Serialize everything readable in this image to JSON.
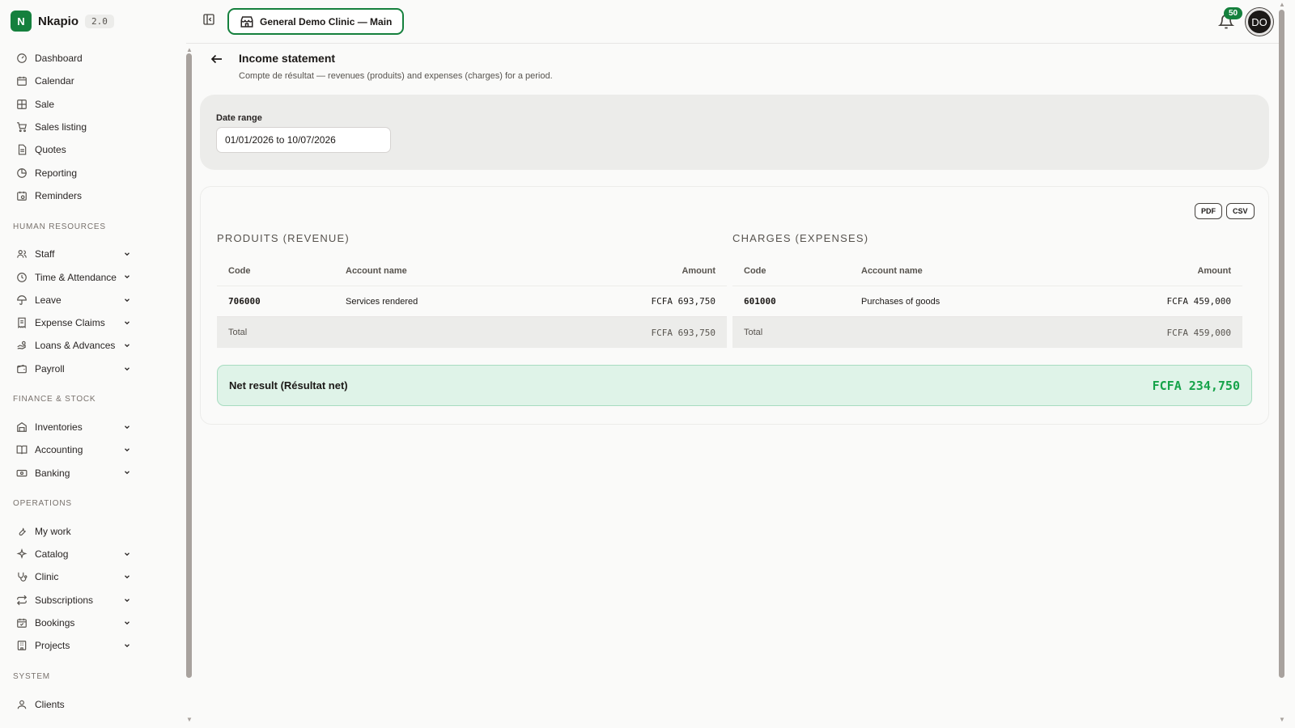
{
  "brand": {
    "initial": "N",
    "name": "Nkapio",
    "version": "2.0"
  },
  "sidebar": {
    "main": [
      {
        "label": "Dashboard",
        "icon": "gauge-icon"
      },
      {
        "label": "Calendar",
        "icon": "calendar-icon"
      },
      {
        "label": "Sale",
        "icon": "pos-grid-icon"
      },
      {
        "label": "Sales listing",
        "icon": "cart-icon"
      },
      {
        "label": "Quotes",
        "icon": "document-icon"
      },
      {
        "label": "Reporting",
        "icon": "pie-chart-icon"
      },
      {
        "label": "Reminders",
        "icon": "calendar-clock-icon"
      }
    ],
    "hr_title": "HUMAN RESOURCES",
    "hr": [
      {
        "label": "Staff",
        "icon": "users-icon"
      },
      {
        "label": "Time & Attendance",
        "icon": "clock-icon"
      },
      {
        "label": "Leave",
        "icon": "umbrella-icon"
      },
      {
        "label": "Expense Claims",
        "icon": "receipt-icon"
      },
      {
        "label": "Loans & Advances",
        "icon": "hand-coins-icon"
      },
      {
        "label": "Payroll",
        "icon": "wallet-icon"
      }
    ],
    "finance_title": "FINANCE & STOCK",
    "finance": [
      {
        "label": "Inventories",
        "icon": "warehouse-icon"
      },
      {
        "label": "Accounting",
        "icon": "book-icon"
      },
      {
        "label": "Banking",
        "icon": "banknote-icon"
      }
    ],
    "ops_title": "OPERATIONS",
    "ops": [
      {
        "label": "My work",
        "icon": "wrench-icon"
      },
      {
        "label": "Catalog",
        "icon": "sparkles-icon"
      },
      {
        "label": "Clinic",
        "icon": "stethoscope-icon"
      },
      {
        "label": "Subscriptions",
        "icon": "repeat-icon"
      },
      {
        "label": "Bookings",
        "icon": "calendar-check-icon"
      },
      {
        "label": "Projects",
        "icon": "building-icon"
      }
    ],
    "system_title": "SYSTEM",
    "system": [
      {
        "label": "Clients",
        "icon": "user-icon"
      }
    ]
  },
  "topbar": {
    "location": "General Demo Clinic — Main",
    "notifications": "50",
    "avatar": "DO"
  },
  "page": {
    "title": "Income statement",
    "subtitle": "Compte de résultat — revenues (produits) and expenses (charges) for a period."
  },
  "filter": {
    "label": "Date range",
    "value": "01/01/2026 to 10/07/2026"
  },
  "export": {
    "pdf": "PDF",
    "csv": "CSV"
  },
  "revenue": {
    "title": "PRODUITS (REVENUE)",
    "headers": {
      "code": "Code",
      "name": "Account name",
      "amount": "Amount"
    },
    "rows": [
      {
        "code": "706000",
        "name": "Services rendered",
        "amount": "FCFA 693,750"
      }
    ],
    "total_label": "Total",
    "total": "FCFA 693,750"
  },
  "expenses": {
    "title": "CHARGES (EXPENSES)",
    "headers": {
      "code": "Code",
      "name": "Account name",
      "amount": "Amount"
    },
    "rows": [
      {
        "code": "601000",
        "name": "Purchases of goods",
        "amount": "FCFA 459,000"
      }
    ],
    "total_label": "Total",
    "total": "FCFA 459,000"
  },
  "net": {
    "label": "Net result (Résultat net)",
    "value": "FCFA 234,750"
  },
  "colors": {
    "brand": "#15803d",
    "net_value": "#16a34a",
    "net_bg": "#dff3e8"
  }
}
